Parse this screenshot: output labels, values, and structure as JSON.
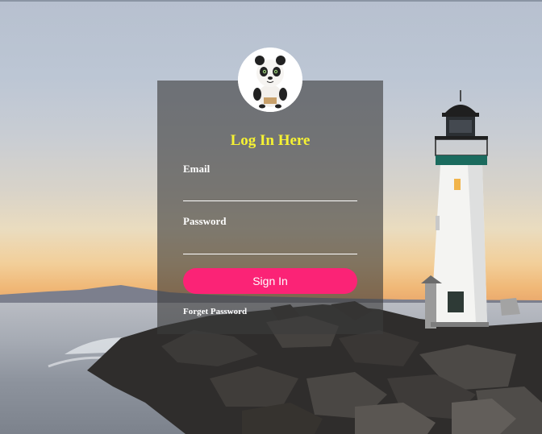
{
  "login": {
    "title": "Log In Here",
    "email_label": "Email",
    "email_value": "",
    "password_label": "Password",
    "password_value": "",
    "signin_label": "Sign In",
    "forget_label": "Forget Password"
  },
  "colors": {
    "title": "#f6f233",
    "button": "#fb2376",
    "card_overlay": "rgba(60,60,60,0.62)"
  },
  "icons": {
    "avatar": "panda-avatar-icon"
  }
}
